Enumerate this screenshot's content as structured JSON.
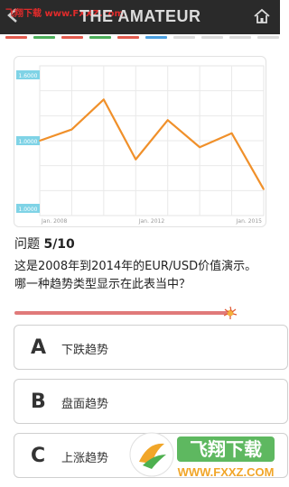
{
  "header": {
    "watermark": "飞翔下载 www.FXXZ.com",
    "title": "THE AMATEUR"
  },
  "progress_segments": [
    {
      "color": "#e25a4d"
    },
    {
      "color": "#4cae5a"
    },
    {
      "color": "#e25a4d"
    },
    {
      "color": "#4cae5a"
    },
    {
      "color": "#e25a4d"
    },
    {
      "color": "#4a9fe0"
    },
    {
      "color": "#dadada"
    },
    {
      "color": "#dadada"
    },
    {
      "color": "#dadada"
    },
    {
      "color": "#dadada"
    }
  ],
  "chart_data": {
    "type": "line",
    "x_tick_labels": [
      "Jan. 2008",
      "Jan. 2012",
      "Jan. 2015"
    ],
    "y_tick_labels": [
      "1.6000",
      "1.0000",
      "1.0000"
    ],
    "values": [
      1.3,
      1.42,
      1.74,
      1.1,
      1.52,
      1.23,
      1.38,
      0.78
    ],
    "ylim": [
      0.5,
      2.1
    ],
    "line_color": "#f0902a",
    "label_box_color": "#7fd3e6",
    "grid": true
  },
  "question": {
    "label": "问题",
    "number": "5/10",
    "text": "这是2008年到2014年的EUR/USD价值演示。 哪一种趋势类型显示在此表当中？"
  },
  "timer": {
    "fraction_remaining": 0.95
  },
  "options": [
    {
      "letter": "A",
      "text": "下跌趋势"
    },
    {
      "letter": "B",
      "text": "盘面趋势"
    },
    {
      "letter": "C",
      "text": "上涨趋势"
    }
  ],
  "logo": {
    "text": "飞翔下载",
    "url": "WWW.FXXZ.COM"
  }
}
